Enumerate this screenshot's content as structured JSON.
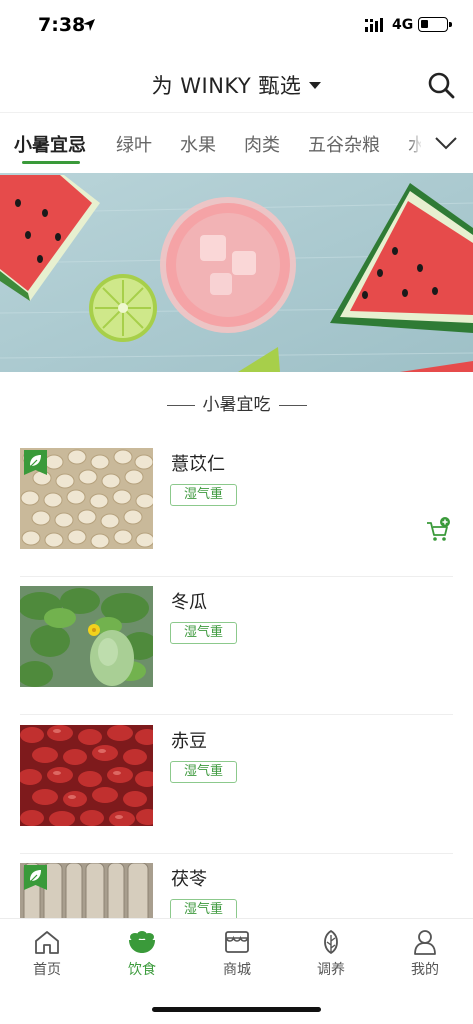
{
  "status_bar": {
    "time": "7:38",
    "network": "4G"
  },
  "header": {
    "title": "为 WINKY 甄选"
  },
  "tabs": [
    {
      "label": "小暑宜忌"
    },
    {
      "label": "绿叶"
    },
    {
      "label": "水果"
    },
    {
      "label": "肉类"
    },
    {
      "label": "五谷杂粮"
    },
    {
      "label": "水"
    }
  ],
  "section": {
    "title": "小暑宜吃"
  },
  "items": [
    {
      "name": "薏苡仁",
      "tag": "湿气重"
    },
    {
      "name": "冬瓜",
      "tag": "湿气重"
    },
    {
      "name": "赤豆",
      "tag": "湿气重"
    },
    {
      "name": "茯苓",
      "tag": "湿气重"
    }
  ],
  "bottom_nav": [
    {
      "label": "首页",
      "icon": "home-icon"
    },
    {
      "label": "饮食",
      "icon": "food-bowl-icon"
    },
    {
      "label": "商城",
      "icon": "shop-icon"
    },
    {
      "label": "调养",
      "icon": "leaf-icon"
    },
    {
      "label": "我的",
      "icon": "person-icon"
    }
  ],
  "colors": {
    "accent": "#3a9a3a",
    "tag_border": "#8cc98c"
  }
}
